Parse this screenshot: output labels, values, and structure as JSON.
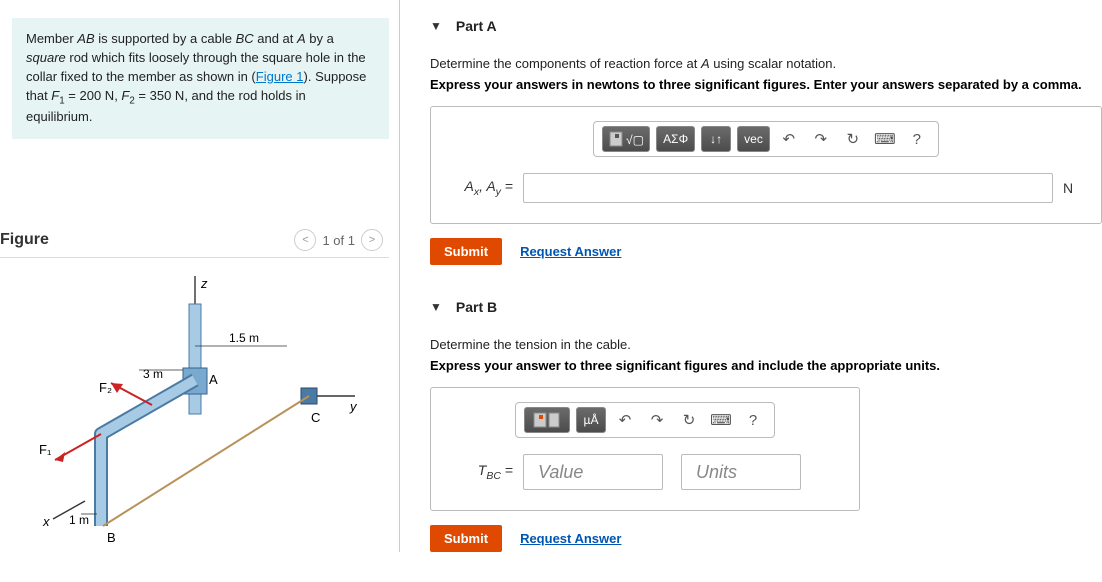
{
  "problem": {
    "text_html": "Member <i>AB</i> is supported by a cable <i>BC</i> and at <i>A</i> by a <i>square</i> rod which fits loosely through the square hole in the collar fixed to the member as shown in (",
    "figure_link": "Figure 1",
    "text_tail": ").",
    "suppose": "Suppose that F₁ = 200 N, F₂ = 350 N, and the rod holds in equilibrium."
  },
  "figure": {
    "title": "Figure",
    "counter": "1 of 1",
    "labels": {
      "z": "z",
      "y": "y",
      "x": "x",
      "A": "A",
      "B": "B",
      "C": "C",
      "F1": "F₁",
      "F2": "F₂",
      "d3m": "3 m",
      "d1_5m": "1.5 m",
      "d1m": "1 m"
    }
  },
  "partA": {
    "title": "Part A",
    "prompt_pre": "Determine the components of reaction force at ",
    "prompt_var": "A",
    "prompt_post": " using scalar notation.",
    "instruct": "Express your answers in newtons to three significant figures. Enter your answers separated by a comma.",
    "eq_label": "Aₓ, A_y =",
    "unit": "N",
    "toolbar": {
      "tmpl": "tmpl",
      "sigma": "ΑΣΦ",
      "arrows": "↓↑",
      "vec": "vec",
      "undo": "↶",
      "redo": "↷",
      "reset": "↻",
      "kbd": "⌨",
      "help": "?"
    },
    "submit": "Submit",
    "request": "Request Answer"
  },
  "partB": {
    "title": "Part B",
    "prompt": "Determine the tension in the cable.",
    "instruct": "Express your answer to three significant figures and include the appropriate units.",
    "eq_label_html": "T_BC =",
    "value_ph": "Value",
    "units_ph": "Units",
    "toolbar": {
      "tmpl": "tmpl",
      "mu": "µÅ",
      "undo": "↶",
      "redo": "↷",
      "reset": "↻",
      "kbd": "⌨",
      "help": "?"
    },
    "submit": "Submit",
    "request": "Request Answer"
  }
}
